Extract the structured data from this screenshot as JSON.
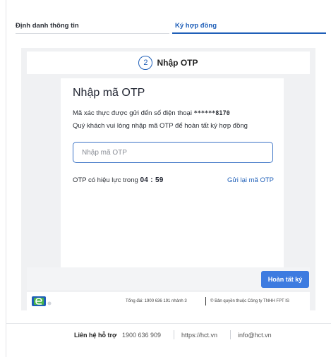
{
  "steps": {
    "tab1_label": "Định danh thông tin",
    "tab2_label": "Ký hợp đồng",
    "active_color": "#1f5fb8"
  },
  "step_header": {
    "number": "2",
    "title": "Nhập OTP"
  },
  "otp": {
    "title": "Nhập mã OTP",
    "message_prefix": "Mã xác thực được gửi đến số điện thoại ",
    "masked_phone": "******8170",
    "message_line2": "Quý khách vui lòng nhập mã OTP để hoàn tất ký hợp đồng",
    "input_placeholder": "Nhập mã OTP",
    "input_value": "",
    "validity_prefix": "OTP có hiệu lực trong ",
    "countdown": "04 : 59",
    "resend_label": "Gửi lại mã OTP"
  },
  "actions": {
    "done_label": "Hoàn tất ký",
    "button_color": "#3d7be0"
  },
  "card_footer": {
    "hotline": "Tổng đài: 1900 636 191 nhánh 3",
    "copyright": "© Bản quyền thuộc Công ty TNHH FPT IS"
  },
  "page_footer": {
    "label": "Liên hệ hỗ trợ",
    "phone": "1900 636 909",
    "website": "https://hct.vn",
    "email": "info@hct.vn"
  }
}
